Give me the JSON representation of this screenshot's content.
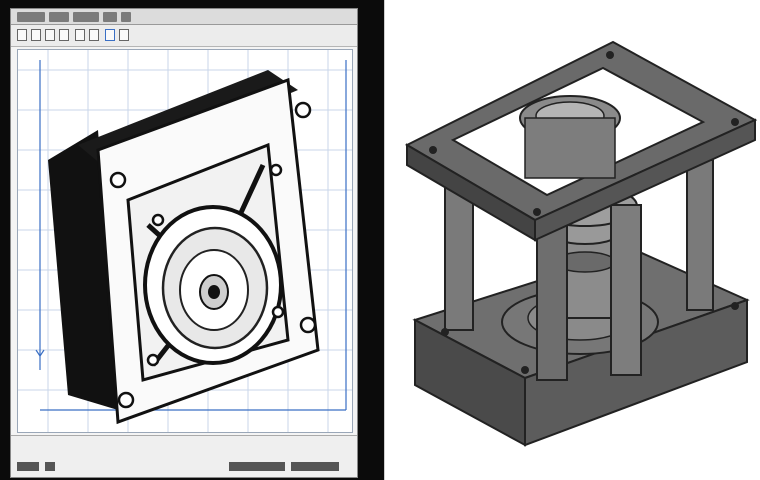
{
  "left_window": {
    "status_text": "",
    "accent_color": "#3a6fc4",
    "grid_color": "#c9d6ea"
  },
  "viewport": {
    "model": "flanged-housing-isometric"
  },
  "right_view": {
    "model": "die-set-press-isometric"
  },
  "icons": {
    "toolbar": [
      "new-file-icon",
      "open-icon",
      "save-icon",
      "print-icon",
      "undo-icon",
      "redo-icon",
      "zoom-icon",
      "rotate-icon"
    ],
    "status": [
      "axis-icon",
      "grid-icon",
      "snap-icon",
      "ortho-icon"
    ]
  }
}
